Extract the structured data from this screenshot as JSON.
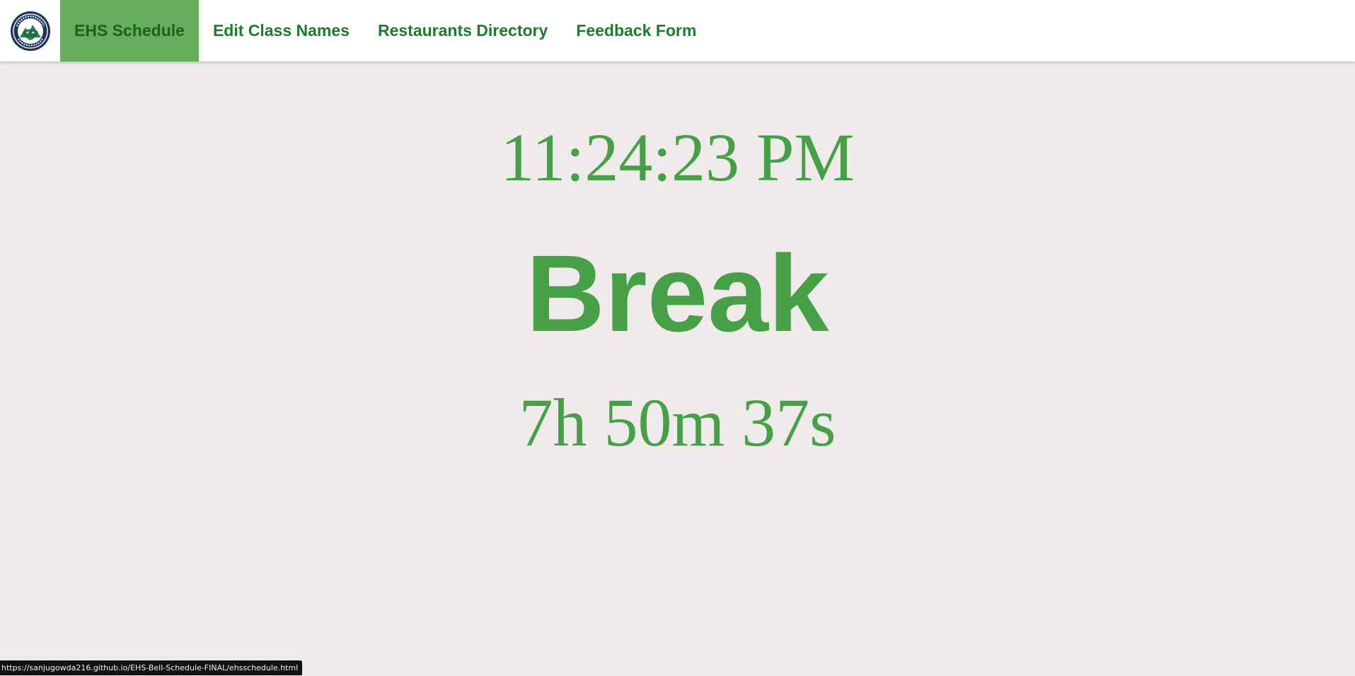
{
  "nav": {
    "logo_icon": "school-logo-icon",
    "items": [
      {
        "label": "EHS Schedule",
        "active": true
      },
      {
        "label": "Edit Class Names",
        "active": false
      },
      {
        "label": "Restaurants Directory",
        "active": false
      },
      {
        "label": "Feedback Form",
        "active": false
      }
    ]
  },
  "main": {
    "current_time": "11:24:23 PM",
    "period": "Break",
    "countdown": "7h 50m 37s"
  },
  "status_bar": {
    "url": "https://sanjugowda216.github.io/EHS-Bell-Schedule-FINAL/ehsschedule.html"
  },
  "colors": {
    "nav_active_bg": "#66ae5e",
    "nav_text": "#1f7a2e",
    "accent_green": "#47a047",
    "page_bg": "#efebeb",
    "logo_navy": "#1d3557"
  }
}
